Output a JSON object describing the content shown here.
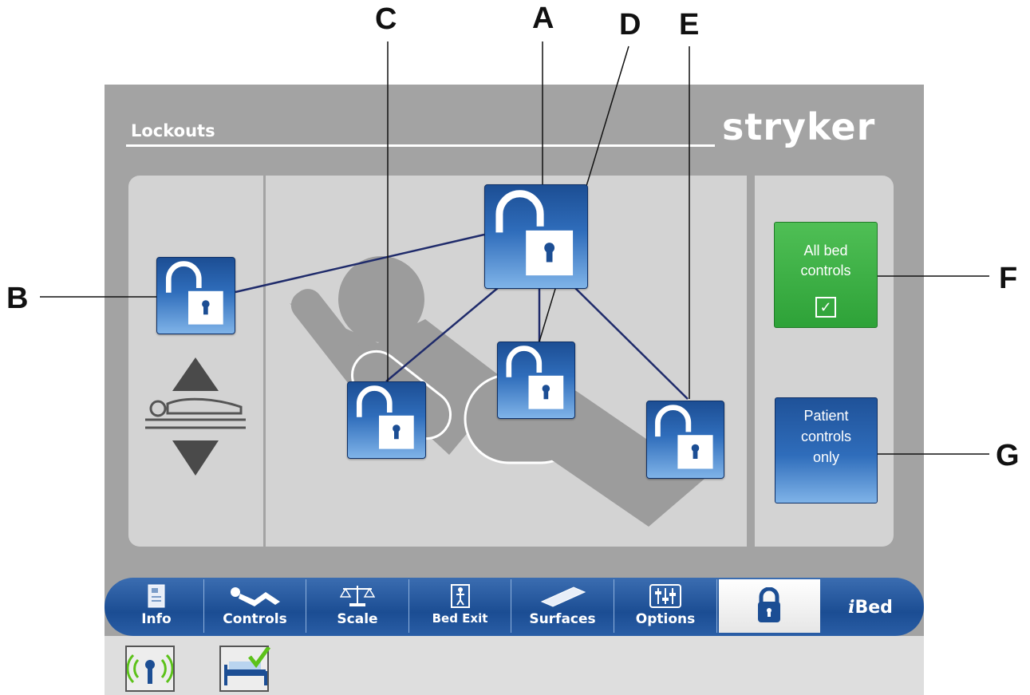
{
  "callouts": {
    "a": "A",
    "b": "B",
    "c": "C",
    "d": "D",
    "e": "E",
    "f": "F",
    "g": "G"
  },
  "header": {
    "title": "Lockouts",
    "brand": "stryker"
  },
  "lockout_controls": {
    "all_bed_controls_line1": "All bed",
    "all_bed_controls_line2": "controls",
    "all_bed_controls_check": "✓",
    "patient_controls_line1": "Patient",
    "patient_controls_line2": "controls",
    "patient_controls_line3": "only"
  },
  "tabs": {
    "info": "Info",
    "controls": "Controls",
    "scale": "Scale",
    "bed_exit": "Bed Exit",
    "surfaces": "Surfaces",
    "options": "Options",
    "ibed_i": "i",
    "ibed": "Bed"
  },
  "colors": {
    "screen_bg": "#a3a3a3",
    "panel_bg": "#d3d3d3",
    "lock_blue": "#1c4e94",
    "all_controls_green": "#3aae43",
    "status_check_green": "#5cc21a"
  },
  "icons": {
    "lock": "unlocked-padlock-icon",
    "hilo_up": "triangle-up-icon",
    "hilo_down": "triangle-down-icon",
    "wireless": "wireless-signal-icon",
    "bed_status": "bed-status-check-icon"
  }
}
